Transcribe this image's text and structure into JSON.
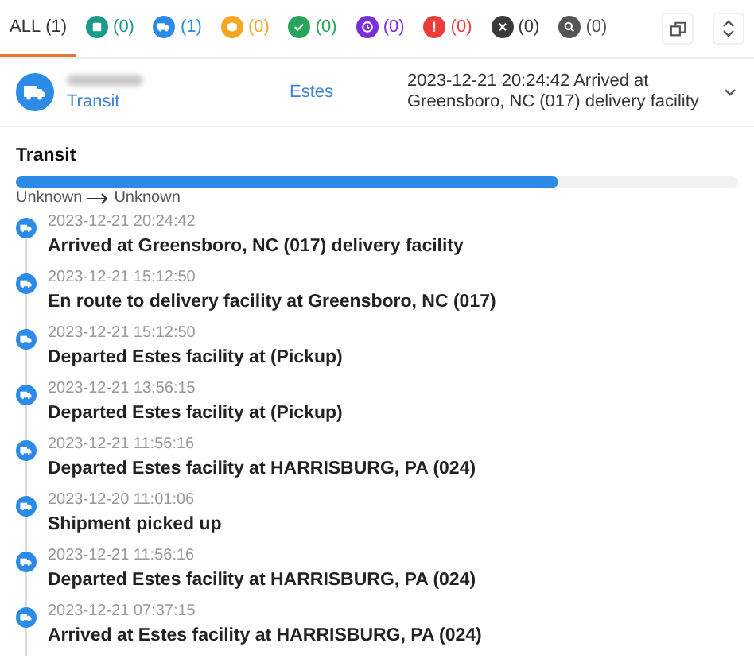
{
  "filter_tabs": [
    {
      "kind": "all",
      "label": "ALL",
      "count": "(1)",
      "selected": true
    },
    {
      "kind": "box",
      "count": "(0)",
      "color": "#1a9a8c",
      "selected": false
    },
    {
      "kind": "truck",
      "count": "(1)",
      "color": "#2b8be6",
      "selected": false
    },
    {
      "kind": "package",
      "count": "(0)",
      "color": "#f5a623",
      "selected": false
    },
    {
      "kind": "check",
      "count": "(0)",
      "color": "#27a55a",
      "selected": false
    },
    {
      "kind": "clock",
      "count": "(0)",
      "color": "#7b2fd6",
      "selected": false
    },
    {
      "kind": "alert",
      "count": "(0)",
      "color": "#ee3b3b",
      "selected": false
    },
    {
      "kind": "cross",
      "count": "(0)",
      "color": "#3a3a3a",
      "selected": false
    },
    {
      "kind": "search",
      "count": "(0)",
      "color": "#555555",
      "selected": false
    }
  ],
  "shipment": {
    "status": "Transit",
    "carrier": "Estes",
    "latest": "2023-12-21 20:24:42 Arrived at Greensboro, NC (017) delivery facility",
    "expanded": false
  },
  "detail": {
    "title": "Transit",
    "level": 0.75,
    "origin": "Unknown",
    "destination": "Unknown"
  },
  "events": [
    {
      "time": "2023-12-21 20:24:42",
      "text": "Arrived at Greensboro, NC (017) delivery facility"
    },
    {
      "time": "2023-12-21 15:12:50",
      "text": "En route to delivery facility at Greensboro, NC (017)"
    },
    {
      "time": "2023-12-21 15:12:50",
      "text": "Departed Estes facility at (Pickup)"
    },
    {
      "time": "2023-12-21 13:56:15",
      "text": "Departed Estes facility at (Pickup)"
    },
    {
      "time": "2023-12-21 11:56:16",
      "text": "Departed Estes facility at HARRISBURG, PA (024)"
    },
    {
      "time": "2023-12-20 11:01:06",
      "text": "Shipment picked up"
    },
    {
      "time": "2023-12-21 11:56:16",
      "text": "Departed Estes facility at HARRISBURG, PA (024)"
    },
    {
      "time": "2023-12-21 07:37:15",
      "text": "Arrived at Estes facility at HARRISBURG, PA (024)"
    }
  ]
}
